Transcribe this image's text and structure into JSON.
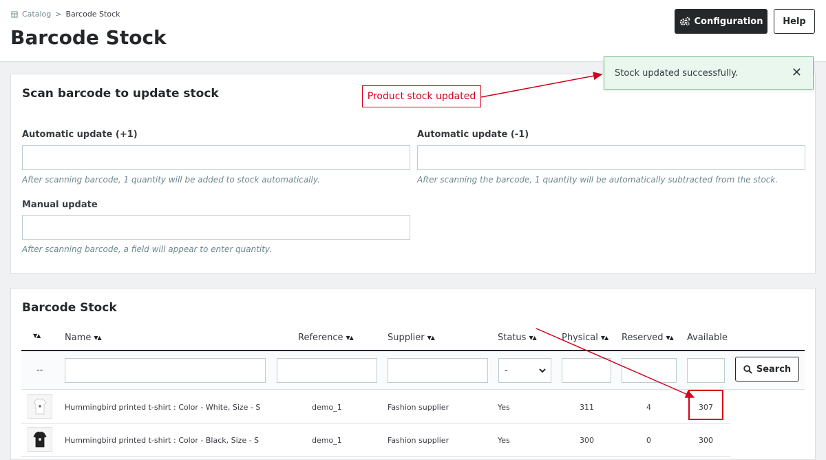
{
  "breadcrumb": {
    "parent": "Catalog",
    "separator": ">",
    "current": "Barcode Stock"
  },
  "page_title": "Barcode Stock",
  "toolbar": {
    "config_label": "Configuration",
    "help_label": "Help"
  },
  "toast": {
    "message": "Stock updated successfully.",
    "close": "✕"
  },
  "annotation": {
    "label": "Product stock updated"
  },
  "scan": {
    "title": "Scan barcode to update stock",
    "auto_plus": {
      "label": "Automatic update (+1)",
      "value": "",
      "help": "After scanning barcode, 1 quantity will be added to stock automatically."
    },
    "auto_minus": {
      "label": "Automatic update (-1)",
      "value": "",
      "help": "After scanning the barcode, 1 quantity will be automatically subtracted from the stock."
    },
    "manual": {
      "label": "Manual update",
      "value": "",
      "help": "After scanning barcode, a field will appear to enter quantity."
    }
  },
  "stock": {
    "title": "Barcode Stock",
    "sort_glyph": "▼▲",
    "columns": [
      "Name",
      "Reference",
      "Supplier",
      "Status",
      "Physical",
      "Reserved",
      "Available"
    ],
    "filter": {
      "dash": "--",
      "status_selected": "-",
      "search_label": "Search"
    },
    "rows": [
      {
        "name": "Hummingbird printed t-shirt : Color - White, Size - S",
        "reference": "demo_1",
        "supplier": "Fashion supplier",
        "status": "Yes",
        "physical": "311",
        "reserved": "4",
        "available": "307",
        "shirt_color": "#ffffff"
      },
      {
        "name": "Hummingbird printed t-shirt : Color - Black, Size - S",
        "reference": "demo_1",
        "supplier": "Fashion supplier",
        "status": "Yes",
        "physical": "300",
        "reserved": "0",
        "available": "300",
        "shirt_color": "#222222"
      }
    ]
  },
  "colors": {
    "accent": "#25282b",
    "annotation": "#d0021b",
    "toast_bg": "#eaf7ef",
    "toast_border": "#70b580"
  }
}
